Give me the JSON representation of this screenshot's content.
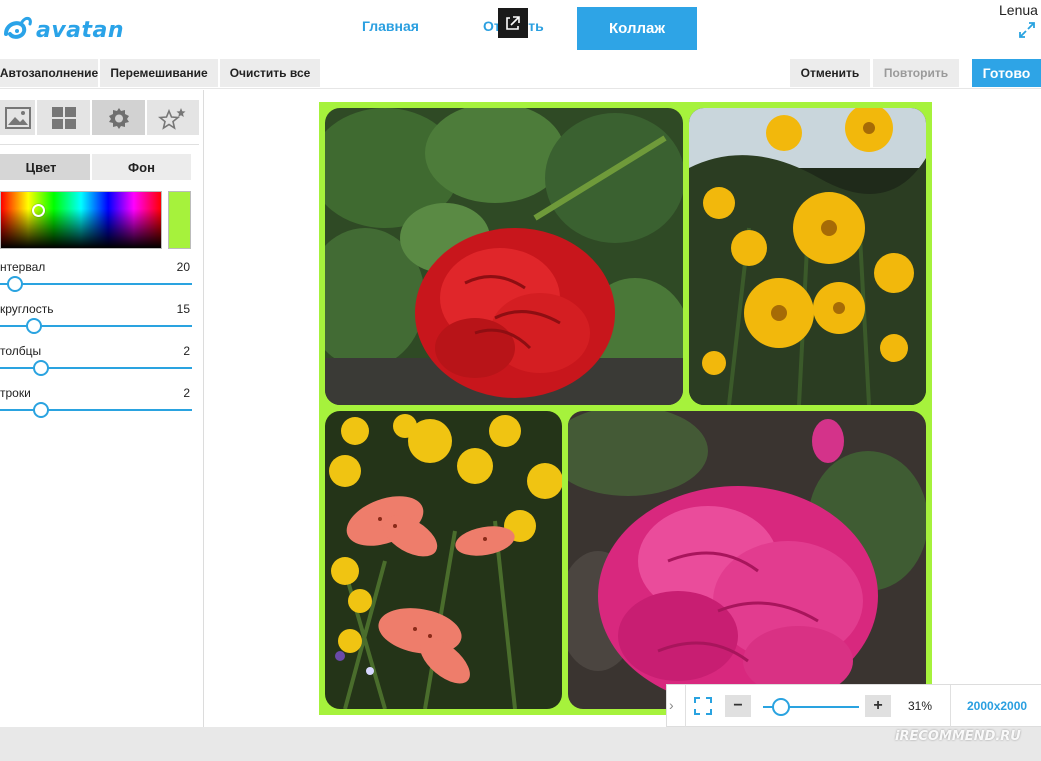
{
  "header": {
    "logo_text": "avatan",
    "nav_home": "Главная",
    "nav_open": "Открыть",
    "collage_button": "Коллаж",
    "username": "Lenua"
  },
  "toolbar": {
    "autofill": "Автозаполнение",
    "shuffle": "Перемешивание",
    "clear_all": "Очистить все",
    "undo": "Отменить",
    "redo": "Повторить",
    "done": "Готово"
  },
  "panel": {
    "tabs": [
      "image-icon",
      "grid-icon",
      "gear-icon",
      "stars-icon"
    ],
    "active_tab": "gear-icon",
    "sub_tabs": {
      "color": "Цвет",
      "background": "Фон"
    },
    "selected_color": "#a6f23c",
    "sliders": [
      {
        "label": "нтервал",
        "value": "20",
        "level": 0.04
      },
      {
        "label": "круглость",
        "value": "15",
        "level": 0.15
      },
      {
        "label": "толбцы",
        "value": "2",
        "level": 0.19
      },
      {
        "label": "троки",
        "value": "2",
        "level": 0.19
      }
    ]
  },
  "collage": {
    "border_color": "#a6f23c",
    "photos": [
      "red-geranium-photo",
      "yellow-flowers-photo",
      "lilies-photo",
      "pink-geranium-photo"
    ]
  },
  "zoom_bar": {
    "zoom": "31%",
    "zoom_level": 0.12,
    "size": "2000x2000"
  },
  "watermark": "iRECOMMEND.RU",
  "colors": {
    "accent": "#2ea4e6",
    "link": "#2a9fe0"
  }
}
